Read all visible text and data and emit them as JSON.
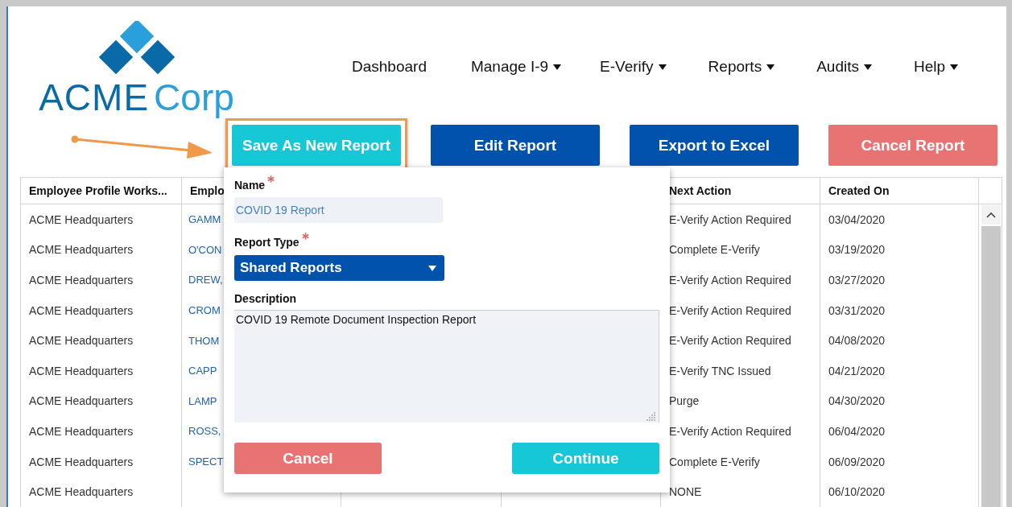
{
  "logo": {
    "first_word": "ACME",
    "second_word": "Corp"
  },
  "nav": [
    {
      "label": "Dashboard",
      "has_menu": false
    },
    {
      "label": "Manage I-9",
      "has_menu": true
    },
    {
      "label": "E-Verify",
      "has_menu": true
    },
    {
      "label": "Reports",
      "has_menu": true
    },
    {
      "label": "Audits",
      "has_menu": true
    },
    {
      "label": "Help",
      "has_menu": true
    }
  ],
  "toolbar": [
    {
      "label": "Save As New Report",
      "kind": "teal",
      "highlighted": true
    },
    {
      "label": "Edit Report",
      "kind": "blue",
      "highlighted": false
    },
    {
      "label": "Export to Excel",
      "kind": "blue",
      "highlighted": false
    },
    {
      "label": "Cancel Report",
      "kind": "red",
      "highlighted": false
    }
  ],
  "table": {
    "headers": {
      "workspace": "Employee Profile Works...",
      "employee": "Emplo",
      "next_action": "Next Action",
      "created_on": "Created On"
    },
    "rows": [
      {
        "workspace": "ACME Headquarters",
        "employee": "GAMM",
        "next_action": "E-Verify Action Required",
        "created_on": "03/04/2020"
      },
      {
        "workspace": "ACME Headquarters",
        "employee": "O'CON",
        "next_action": "Complete E-Verify",
        "created_on": "03/19/2020"
      },
      {
        "workspace": "ACME Headquarters",
        "employee": "DREW,",
        "next_action": "E-Verify Action Required",
        "created_on": "03/27/2020"
      },
      {
        "workspace": "ACME Headquarters",
        "employee": "CROM",
        "next_action": "E-Verify Action Required",
        "created_on": "03/31/2020"
      },
      {
        "workspace": "ACME Headquarters",
        "employee": "THOM",
        "next_action": "E-Verify Action Required",
        "created_on": "04/08/2020"
      },
      {
        "workspace": "ACME Headquarters",
        "employee": "CAPP",
        "next_action": "E-Verify TNC Issued",
        "created_on": "04/21/2020"
      },
      {
        "workspace": "ACME Headquarters",
        "employee": "LAMP",
        "next_action": "Purge",
        "created_on": "04/30/2020"
      },
      {
        "workspace": "ACME Headquarters",
        "employee": "ROSS,",
        "next_action": "E-Verify Action Required",
        "created_on": "06/04/2020"
      },
      {
        "workspace": "ACME Headquarters",
        "employee": "SPECT",
        "next_action": "Complete E-Verify",
        "created_on": "06/09/2020"
      },
      {
        "workspace": "ACME Headquarters",
        "next_action": "NONE",
        "created_on": "06/10/2020"
      }
    ]
  },
  "dialog": {
    "name": {
      "label": "Name",
      "required": true,
      "value": "COVID 19 Report"
    },
    "report_type": {
      "label": "Report Type",
      "required": true,
      "value": "Shared Reports"
    },
    "description": {
      "label": "Description",
      "required": false,
      "value": "COVID 19 Remote Document Inspection Report"
    },
    "buttons": [
      {
        "label": "Cancel",
        "kind": "red"
      },
      {
        "label": "Continue",
        "kind": "teal"
      }
    ]
  }
}
